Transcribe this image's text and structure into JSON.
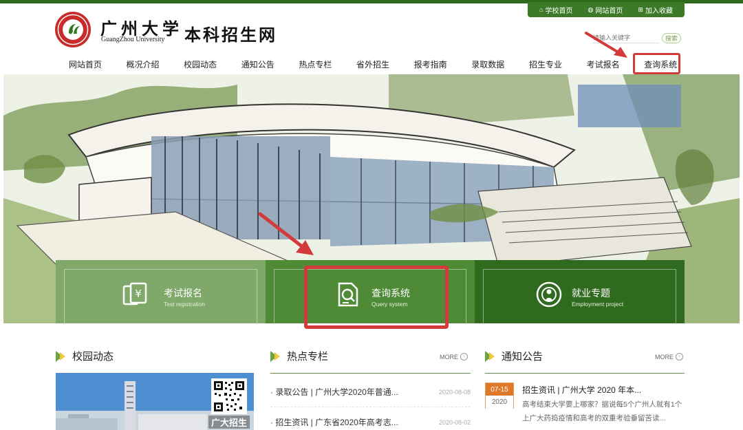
{
  "top_links": [
    {
      "icon": "house-icon",
      "label": "学校首页"
    },
    {
      "icon": "globe-icon",
      "label": "网站首页"
    },
    {
      "icon": "plus-icon",
      "label": "加入收藏"
    }
  ],
  "brand": {
    "university_cn": "广州大学",
    "university_en": "GuangZhou University",
    "site_name": "本科招生网"
  },
  "search": {
    "placeholder": "请输入关键字",
    "button_label": "搜索"
  },
  "nav": {
    "items": [
      "网站首页",
      "概况介绍",
      "校园动态",
      "通知公告",
      "热点专栏",
      "省外招生",
      "报考指南",
      "录取数据",
      "招生专业",
      "考试报名",
      "查询系统"
    ],
    "highlighted": "查询系统"
  },
  "cards": [
    {
      "icon": "document-yen-icon",
      "title": "考试报名",
      "subtitle": "Test registration"
    },
    {
      "icon": "search-document-icon",
      "title": "查询系统",
      "subtitle": "Query system"
    },
    {
      "icon": "broadcast-person-icon",
      "title": "就业专题",
      "subtitle": "Employment project"
    }
  ],
  "campus_news": {
    "title": "校园动态",
    "photo_caption": "广大招生"
  },
  "hot_topics": {
    "title": "热点专栏",
    "more_label": "MORE",
    "items": [
      {
        "text": "· 录取公告 | 广州大学2020年普通...",
        "date": "2020-08-08"
      },
      {
        "text": "· 招生资讯 | 广东省2020年高考志...",
        "date": "2020-08-02"
      }
    ]
  },
  "notices": {
    "title": "通知公告",
    "more_label": "MORE",
    "items": [
      {
        "month_day": "07-15",
        "year": "2020",
        "title": "招生资讯 | 广州大学 2020 年本...",
        "desc": "高考结束大学要上哪家？据说每5个广州人就有1个上广大药捣疫情和高考的双重考验垂留苦读..."
      }
    ]
  },
  "colors": {
    "brand_green": "#2e6a1c",
    "highlight_red": "#d33b3b",
    "date_orange": "#e0782a"
  }
}
